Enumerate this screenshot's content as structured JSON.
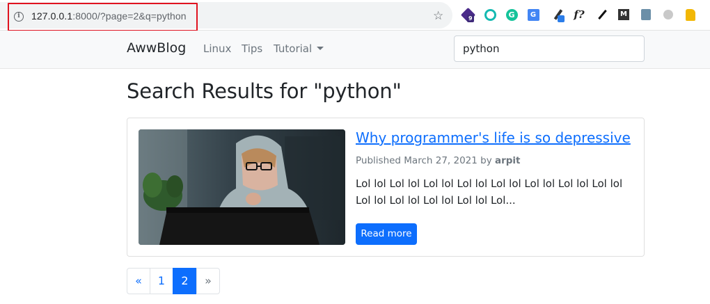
{
  "browser": {
    "url_host": "127.0.0.1",
    "url_rest": ":8000/?page=2&q=python",
    "icons": [
      "info-icon",
      "star-icon",
      "extension-icons"
    ],
    "extensions": {
      "badge_count": "9",
      "g_letter": "G",
      "ext_letters": "G",
      "f_label": "f?",
      "m_letter": "M"
    }
  },
  "navbar": {
    "brand": "AwwBlog",
    "links": [
      "Linux",
      "Tips",
      "Tutorial"
    ],
    "search_value": "python"
  },
  "main": {
    "heading": "Search Results for \"python\""
  },
  "post": {
    "title": "Why programmer's life is so depressive",
    "meta_prefix": "Published March 27, 2021 by ",
    "author": "arpit",
    "excerpt": "Lol lol Lol lol Lol lol Lol lol Lol lol Lol lol Lol lol Lol lol Lol lol Lol lol Lol lol Lol lol Lol...",
    "read_more_label": "Read more"
  },
  "pagination": {
    "prev": "«",
    "pages": [
      "1",
      "2"
    ],
    "current": "2",
    "next": "»"
  },
  "colors": {
    "primary": "#0d6efd",
    "highlight_box": "#e0121f",
    "navbar_bg": "#f8f9fa"
  }
}
